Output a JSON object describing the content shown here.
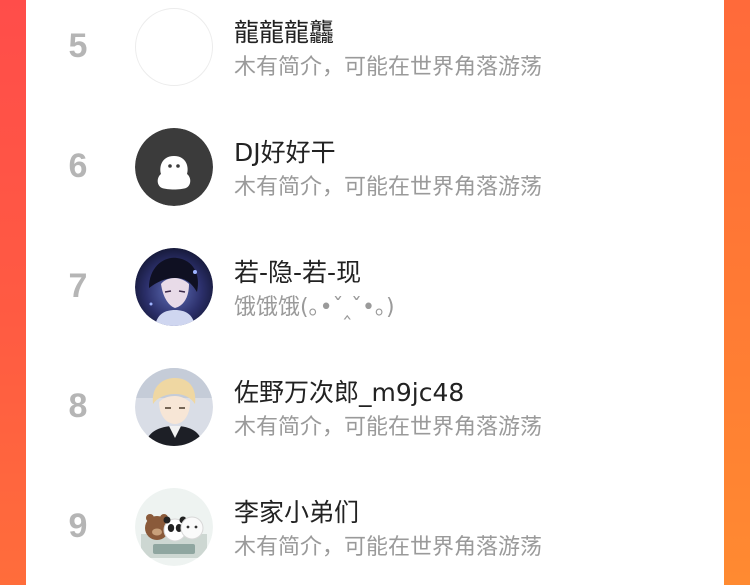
{
  "colors": {
    "background_gradient_start": "#ff5a47",
    "background_gradient_end": "#ff7a33",
    "rank_color": "#b5b5b5",
    "name_color": "#222222",
    "bio_color": "#9a9a9a"
  },
  "ranking": {
    "items": [
      {
        "rank": "5",
        "name": "龍龍龍龘",
        "bio": "木有简介，可能在世界角落游荡",
        "avatar": "empty-avatar"
      },
      {
        "rank": "6",
        "name": "DJ好好干",
        "bio": "木有简介，可能在世界角落游荡",
        "avatar": "ghost-avatar"
      },
      {
        "rank": "7",
        "name": "若-隐-若-现",
        "bio": "饿饿饿(｡•ˇ‸ˇ•｡)",
        "avatar": "anime-boy-avatar"
      },
      {
        "rank": "8",
        "name": "佐野万次郎_m9jc48",
        "bio": "木有简介，可能在世界角落游荡",
        "avatar": "anime-blond-avatar"
      },
      {
        "rank": "9",
        "name": "李家小弟们",
        "bio": "木有简介，可能在世界角落游荡",
        "avatar": "bears-avatar"
      }
    ]
  }
}
